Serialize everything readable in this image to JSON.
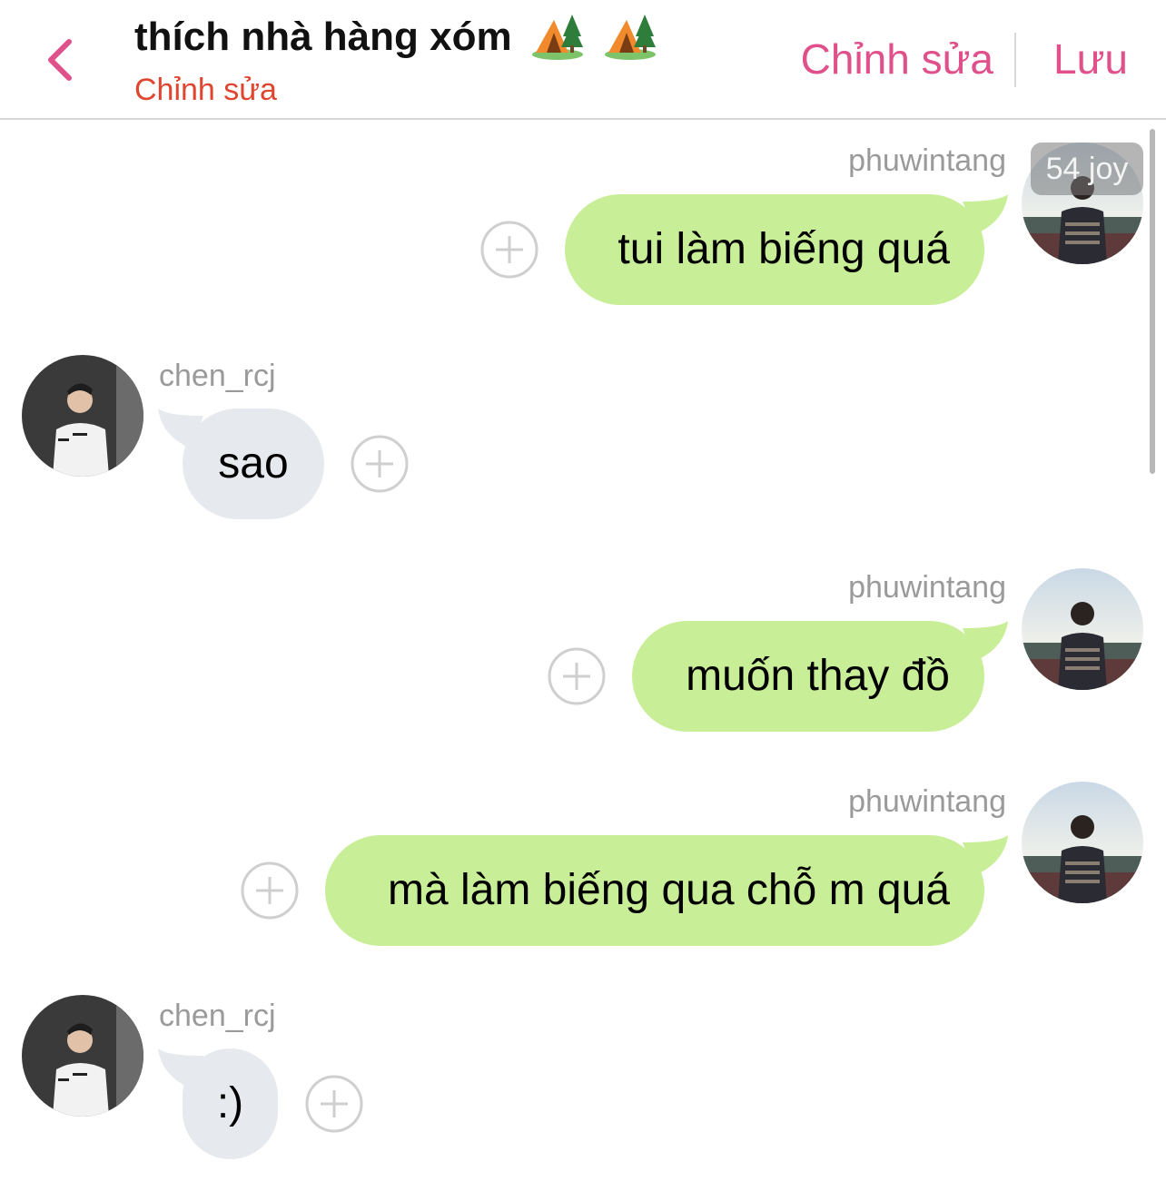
{
  "header": {
    "title": "thích nhà hàng xóm",
    "title_emoji": [
      "camping-tent-icon",
      "camping-tent-icon"
    ],
    "subtitle": "Chỉnh sửa",
    "edit_label": "Chỉnh sửa",
    "save_label": "Lưu",
    "accent_color": "#e0508a",
    "subtitle_color": "#e0452f"
  },
  "badge": {
    "text": "54 joy"
  },
  "messages": [
    {
      "sender": "phuwintang",
      "side": "right",
      "text": "tui làm biếng quá"
    },
    {
      "sender": "chen_rcj",
      "side": "left",
      "text": "sao"
    },
    {
      "sender": "phuwintang",
      "side": "right",
      "text": "muốn thay đồ"
    },
    {
      "sender": "phuwintang",
      "side": "right",
      "text": "mà làm biếng qua chỗ m quá"
    },
    {
      "sender": "chen_rcj",
      "side": "left",
      "text": ":)"
    }
  ],
  "colors": {
    "right_bubble": "#c9ee98",
    "left_bubble": "#e6e9ed",
    "username": "#9a9a9a"
  }
}
